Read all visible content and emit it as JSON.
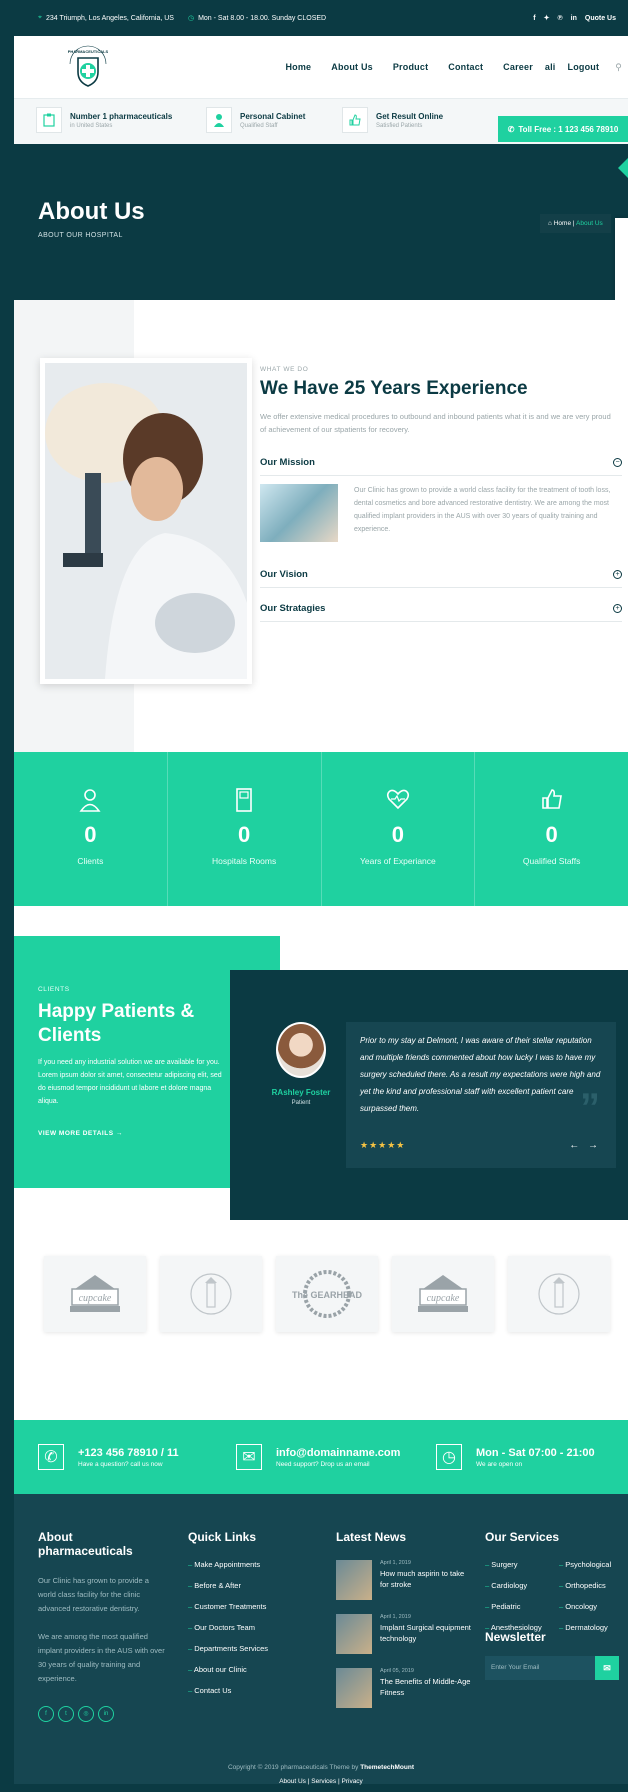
{
  "topbar": {
    "address": "234 Triumph, Los Angeles, California, US",
    "hours": "Mon - Sat 8.00 - 18.00. Sunday CLOSED",
    "quote_label": "Quote Us"
  },
  "logo": {
    "text": "PHARMACEUTICALS"
  },
  "nav": [
    "Home",
    "About Us",
    "Product",
    "Contact",
    "Career",
    "ali",
    "Logout"
  ],
  "infobar": [
    {
      "title": "Number 1 pharmaceuticals",
      "sub": "in United States"
    },
    {
      "title": "Personal Cabinet",
      "sub": "Qualified Staff"
    },
    {
      "title": "Get Result Online",
      "sub": "Satisfied Patients"
    }
  ],
  "toll_free": "Toll Free : 1 123 456 78910",
  "hero": {
    "title": "About Us",
    "subtitle": "ABOUT OUR HOSPITAL",
    "crumb_home": "Home",
    "crumb_current": "About Us"
  },
  "about": {
    "eyebrow": "WHAT WE DO",
    "title": "We Have 25 Years Experience",
    "intro": "We offer extensive medical procedures to outbound and inbound patients what it is and we are very proud of achievement of our stpatients for recovery.",
    "mission_title": "Our Mission",
    "mission_text": "Our Clinic has grown to provide a world class facility for the treatment of tooth loss, dental cosmetics and bore advanced restorative dentistry. We are among the most qualified implant providers in the AUS with over 30 years of quality training and experience.",
    "vision_title": "Our Vision",
    "strategies_title": "Our Stratagies"
  },
  "stats": [
    {
      "value": "0",
      "label": "Clients",
      "icon": "user-icon"
    },
    {
      "value": "0",
      "label": "Hospitals Rooms",
      "icon": "door-icon"
    },
    {
      "value": "0",
      "label": "Years of Experiance",
      "icon": "heart-icon"
    },
    {
      "value": "0",
      "label": "Qualified Staffs",
      "icon": "thumbs-up-icon"
    }
  ],
  "testimonials": {
    "eyebrow": "CLIENTS",
    "title": "Happy Patients & Clients",
    "desc": "If you need any industrial solution we are available for you. Lorem ipsum dolor sit amet, consectetur adipiscing elit, sed do eiusmod tempor incididunt ut labore et dolore magna aliqua.",
    "view_more": "VIEW MORE DETAILS",
    "name": "RAshley Foster",
    "role": "Patient",
    "quote": "Prior to my stay at Delmont, I was aware of their stellar reputation and multiple friends commented about how lucky I was to have my surgery scheduled there. As a result my expectations were high and yet the kind and professional staff with excellent patient care surpassed them.",
    "rating": 5
  },
  "brands": [
    "cupcake",
    "lighthouse",
    "The GEARHEAD",
    "cupcake",
    "lighthouse"
  ],
  "contact": [
    {
      "title": "+123 456 78910 / 11",
      "sub": "Have a question? call us now"
    },
    {
      "title": "info@domainname.com",
      "sub": "Need support? Drop us an email"
    },
    {
      "title": "Mon - Sat 07:00 - 21:00",
      "sub": "We are open on"
    }
  ],
  "footer": {
    "about_title": "About pharmaceuticals",
    "about_p1": "Our Clinic has grown to provide a world class facility for the clinic advanced restorative dentistry.",
    "about_p2": "We are among the most qualified implant providers in the AUS with over 30 years of quality training and experience.",
    "links_title": "Quick Links",
    "links": [
      "Make Appointments",
      "Before & After",
      "Customer Treatments",
      "Our Doctors Team",
      "Departments Services",
      "About our Clinic",
      "Contact Us"
    ],
    "news_title": "Latest News",
    "news": [
      {
        "date": "April 1, 2019",
        "title": "How much aspirin to take for stroke"
      },
      {
        "date": "April 1, 2019",
        "title": "Implant Surgical equipment technology"
      },
      {
        "date": "April 05, 2019",
        "title": "The Benefits of Middle-Age Fitness"
      }
    ],
    "services_title": "Our Services",
    "services": [
      "Surgery",
      "Psychological",
      "Cardiology",
      "Orthopedics",
      "Pediatric",
      "Oncology",
      "Anesthesiology",
      "Dermatology"
    ],
    "newsletter_title": "Newsletter",
    "newsletter_placeholder": "Enter Your Email",
    "copyright": "Copyright © 2019 pharmaceuticals Theme by",
    "theme_by": "ThemetechMount",
    "bottom_links": [
      "About Us",
      "Services",
      "Privacy"
    ]
  },
  "colors": {
    "navy": "#0b3a43",
    "teal": "#1fd1a0",
    "footer": "#164651"
  }
}
